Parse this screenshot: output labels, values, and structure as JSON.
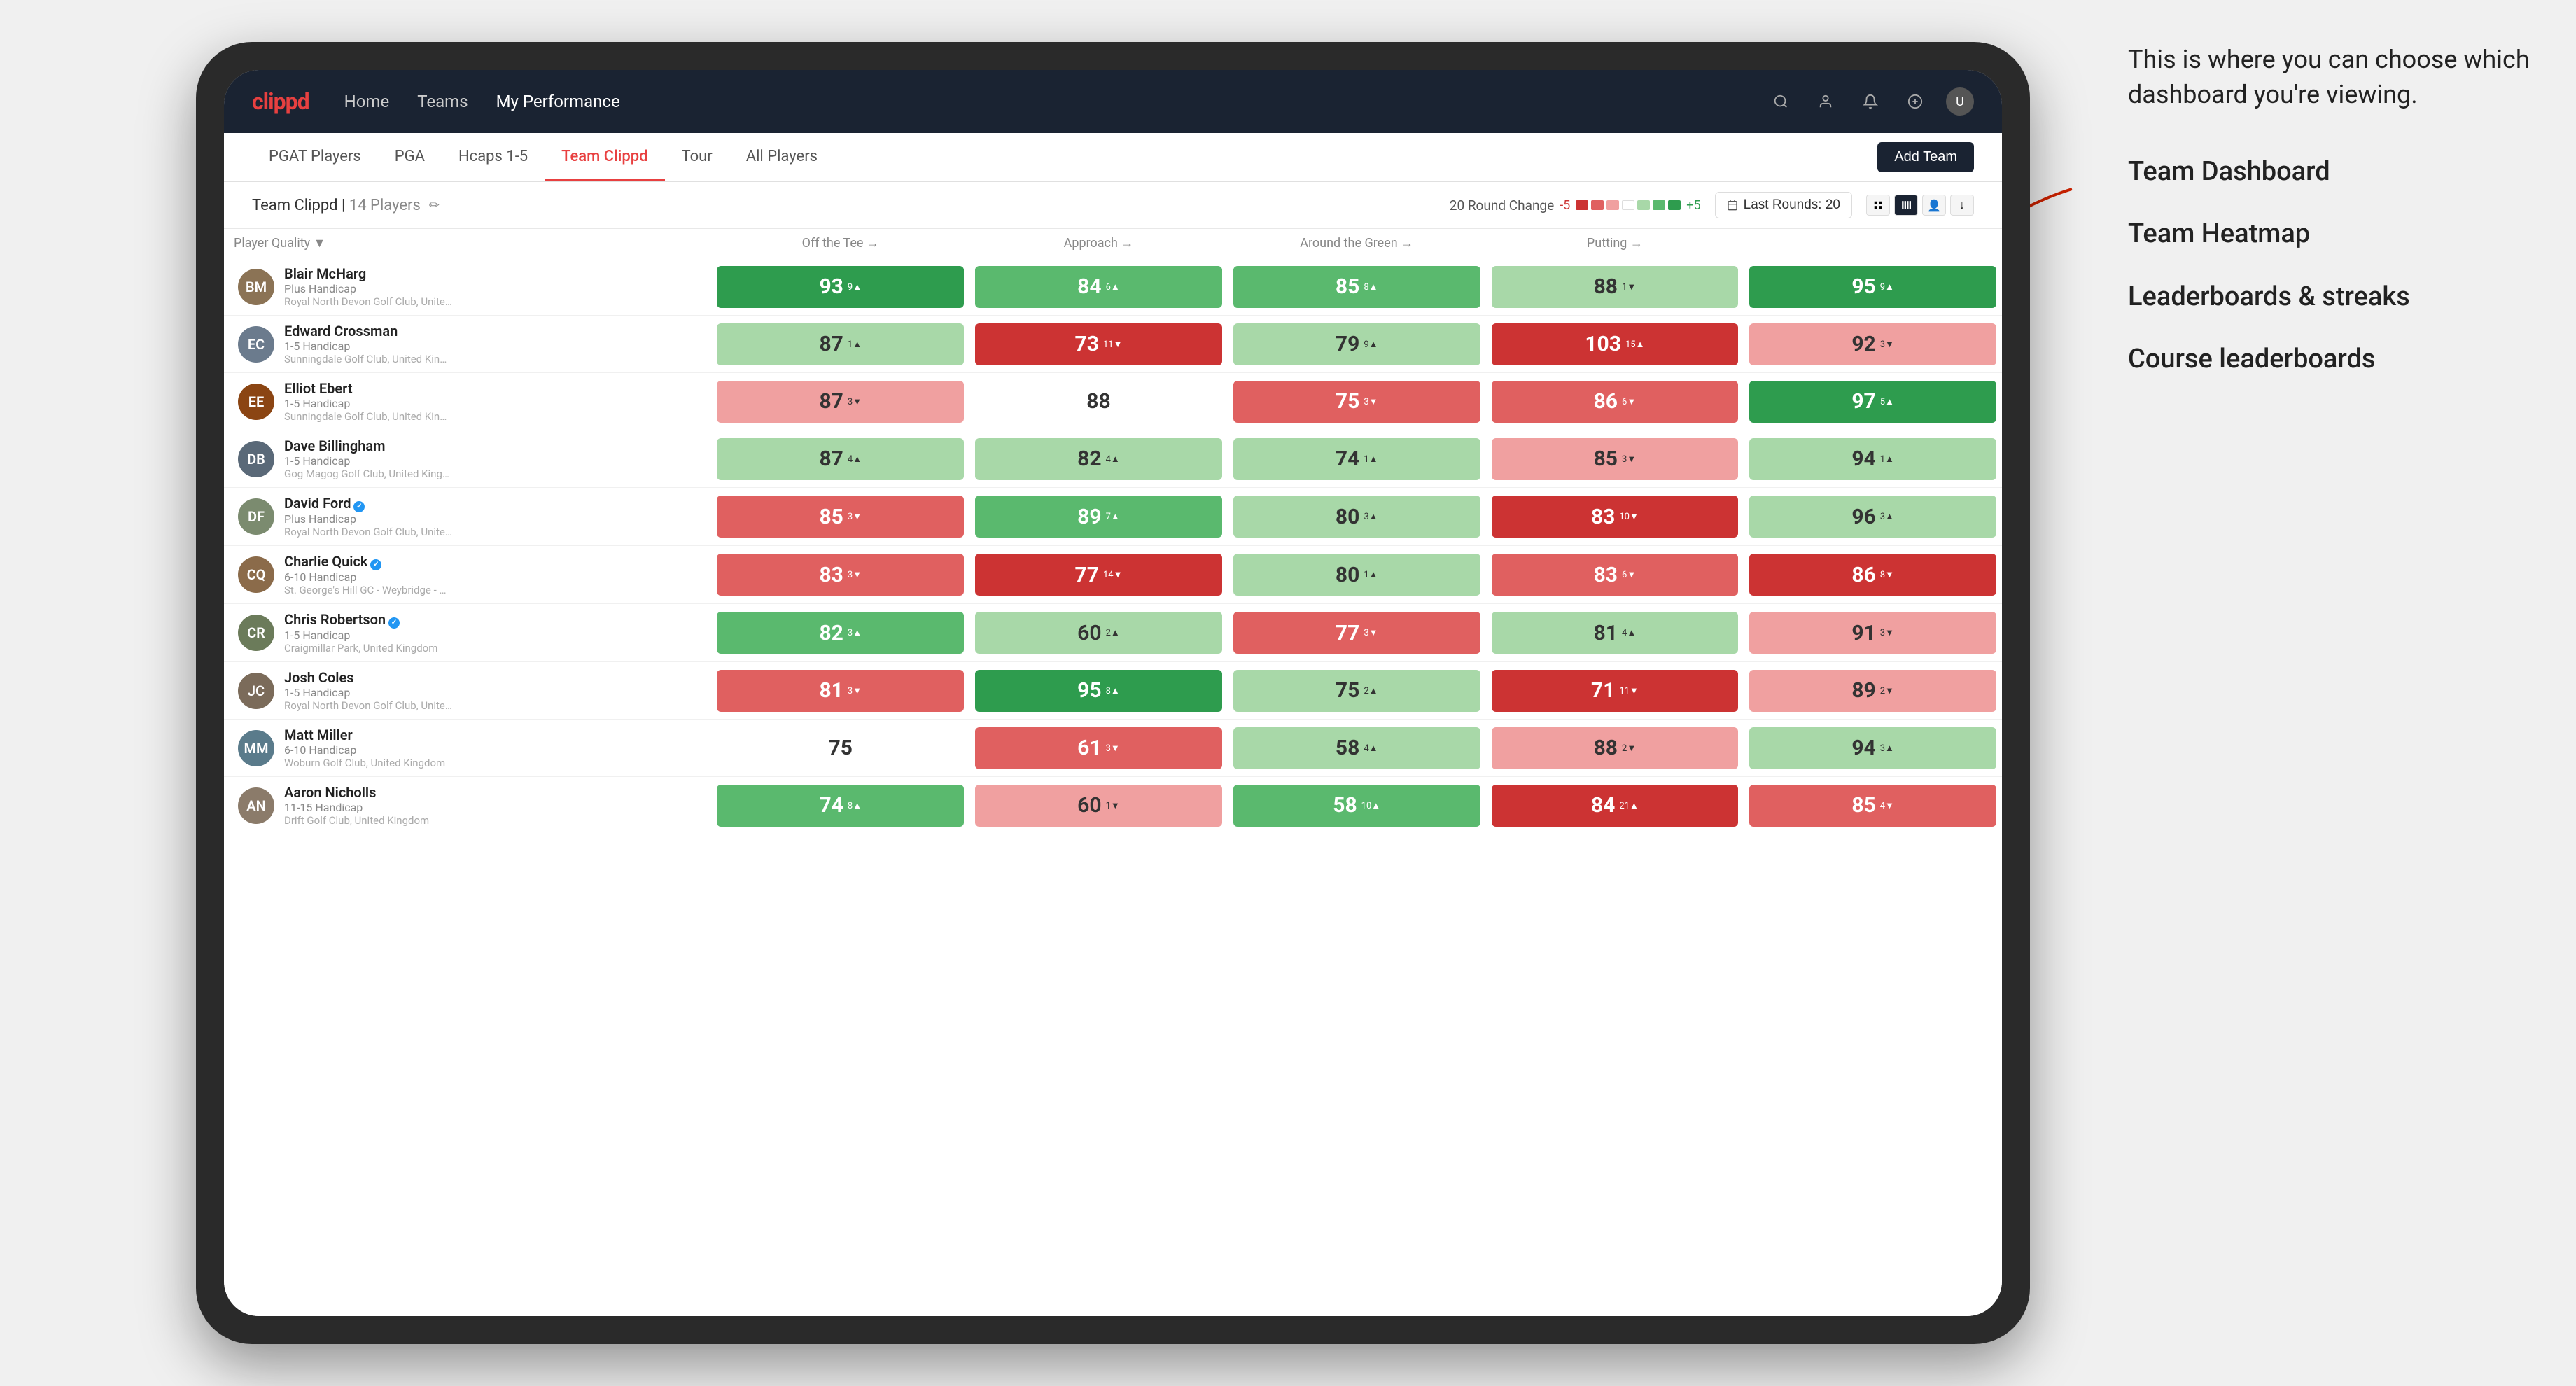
{
  "annotation": {
    "bubble_text": "This is where you can choose which dashboard you're viewing.",
    "list_items": [
      "Team Dashboard",
      "Team Heatmap",
      "Leaderboards & streaks",
      "Course leaderboards"
    ]
  },
  "navbar": {
    "logo": "clippd",
    "items": [
      {
        "label": "Home",
        "active": false
      },
      {
        "label": "Teams",
        "active": false
      },
      {
        "label": "My Performance",
        "active": true
      }
    ],
    "icons": [
      "search",
      "person",
      "bell",
      "circle-plus",
      "avatar"
    ]
  },
  "tabbar": {
    "tabs": [
      {
        "label": "PGAT Players",
        "active": false
      },
      {
        "label": "PGA",
        "active": false
      },
      {
        "label": "Hcaps 1-5",
        "active": false
      },
      {
        "label": "Team Clippd",
        "active": true
      },
      {
        "label": "Tour",
        "active": false
      },
      {
        "label": "All Players",
        "active": false
      }
    ],
    "add_team_label": "Add Team"
  },
  "team_header": {
    "title": "Team Clippd",
    "player_count": "14 Players",
    "round_change_label": "20 Round Change",
    "round_change_min": "-5",
    "round_change_max": "+5",
    "last_rounds_label": "Last Rounds:",
    "last_rounds_value": "20"
  },
  "table": {
    "columns": [
      {
        "key": "player",
        "label": "Player Quality ↓"
      },
      {
        "key": "off_tee",
        "label": "Off the Tee →"
      },
      {
        "key": "approach",
        "label": "Approach →"
      },
      {
        "key": "around_green",
        "label": "Around the Green →"
      },
      {
        "key": "putting",
        "label": "Putting →"
      }
    ],
    "players": [
      {
        "name": "Blair McHarg",
        "handicap": "Plus Handicap",
        "club": "Royal North Devon Golf Club, United Kingdom",
        "avatar_color": "#8B7355",
        "initials": "BM",
        "off_tee": {
          "value": "93",
          "change": "9",
          "dir": "up",
          "bg": "green-strong"
        },
        "approach": {
          "value": "84",
          "change": "6",
          "dir": "up",
          "bg": "green-medium"
        },
        "around_green": {
          "value": "85",
          "change": "8",
          "dir": "up",
          "bg": "green-medium"
        },
        "putting": {
          "value": "88",
          "change": "1",
          "dir": "down",
          "bg": "green-light"
        },
        "quality": {
          "value": "95",
          "change": "9",
          "dir": "up",
          "bg": "green-strong"
        }
      },
      {
        "name": "Edward Crossman",
        "handicap": "1-5 Handicap",
        "club": "Sunningdale Golf Club, United Kingdom",
        "avatar_color": "#6B7B8D",
        "initials": "EC",
        "off_tee": {
          "value": "87",
          "change": "1",
          "dir": "up",
          "bg": "green-light"
        },
        "approach": {
          "value": "73",
          "change": "11",
          "dir": "down",
          "bg": "red-strong"
        },
        "around_green": {
          "value": "79",
          "change": "9",
          "dir": "up",
          "bg": "green-light"
        },
        "putting": {
          "value": "103",
          "change": "15",
          "dir": "up",
          "bg": "red-strong"
        },
        "quality": {
          "value": "92",
          "change": "3",
          "dir": "down",
          "bg": "red-light"
        }
      },
      {
        "name": "Elliot Ebert",
        "handicap": "1-5 Handicap",
        "club": "Sunningdale Golf Club, United Kingdom",
        "avatar_color": "#8B4513",
        "initials": "EE",
        "off_tee": {
          "value": "87",
          "change": "3",
          "dir": "down",
          "bg": "red-light"
        },
        "approach": {
          "value": "88",
          "change": "",
          "dir": "none",
          "bg": "white"
        },
        "around_green": {
          "value": "75",
          "change": "3",
          "dir": "down",
          "bg": "red-medium"
        },
        "putting": {
          "value": "86",
          "change": "6",
          "dir": "down",
          "bg": "red-medium"
        },
        "quality": {
          "value": "97",
          "change": "5",
          "dir": "up",
          "bg": "green-strong"
        }
      },
      {
        "name": "Dave Billingham",
        "handicap": "1-5 Handicap",
        "club": "Gog Magog Golf Club, United Kingdom",
        "avatar_color": "#5A6978",
        "initials": "DB",
        "off_tee": {
          "value": "87",
          "change": "4",
          "dir": "up",
          "bg": "green-light"
        },
        "approach": {
          "value": "82",
          "change": "4",
          "dir": "up",
          "bg": "green-light"
        },
        "around_green": {
          "value": "74",
          "change": "1",
          "dir": "up",
          "bg": "green-light"
        },
        "putting": {
          "value": "85",
          "change": "3",
          "dir": "down",
          "bg": "red-light"
        },
        "quality": {
          "value": "94",
          "change": "1",
          "dir": "up",
          "bg": "green-light"
        }
      },
      {
        "name": "David Ford",
        "handicap": "Plus Handicap",
        "club": "Royal North Devon Golf Club, United Kingdom",
        "avatar_color": "#7B8B6F",
        "initials": "DF",
        "verified": true,
        "off_tee": {
          "value": "85",
          "change": "3",
          "dir": "down",
          "bg": "red-medium"
        },
        "approach": {
          "value": "89",
          "change": "7",
          "dir": "up",
          "bg": "green-medium"
        },
        "around_green": {
          "value": "80",
          "change": "3",
          "dir": "up",
          "bg": "green-light"
        },
        "putting": {
          "value": "83",
          "change": "10",
          "dir": "down",
          "bg": "red-strong"
        },
        "quality": {
          "value": "96",
          "change": "3",
          "dir": "up",
          "bg": "green-light"
        }
      },
      {
        "name": "Charlie Quick",
        "handicap": "6-10 Handicap",
        "club": "St. George's Hill GC - Weybridge - Surrey, Uni...",
        "avatar_color": "#8B6B4A",
        "initials": "CQ",
        "verified": true,
        "off_tee": {
          "value": "83",
          "change": "3",
          "dir": "down",
          "bg": "red-medium"
        },
        "approach": {
          "value": "77",
          "change": "14",
          "dir": "down",
          "bg": "red-strong"
        },
        "around_green": {
          "value": "80",
          "change": "1",
          "dir": "up",
          "bg": "green-light"
        },
        "putting": {
          "value": "83",
          "change": "6",
          "dir": "down",
          "bg": "red-medium"
        },
        "quality": {
          "value": "86",
          "change": "8",
          "dir": "down",
          "bg": "red-strong"
        }
      },
      {
        "name": "Chris Robertson",
        "handicap": "1-5 Handicap",
        "club": "Craigmillar Park, United Kingdom",
        "avatar_color": "#6B7B5A",
        "initials": "CR",
        "verified": true,
        "off_tee": {
          "value": "82",
          "change": "3",
          "dir": "up",
          "bg": "green-medium"
        },
        "approach": {
          "value": "60",
          "change": "2",
          "dir": "up",
          "bg": "green-light"
        },
        "around_green": {
          "value": "77",
          "change": "3",
          "dir": "down",
          "bg": "red-medium"
        },
        "putting": {
          "value": "81",
          "change": "4",
          "dir": "up",
          "bg": "green-light"
        },
        "quality": {
          "value": "91",
          "change": "3",
          "dir": "down",
          "bg": "red-light"
        }
      },
      {
        "name": "Josh Coles",
        "handicap": "1-5 Handicap",
        "club": "Royal North Devon Golf Club, United Kingdom",
        "avatar_color": "#7B6B5A",
        "initials": "JC",
        "off_tee": {
          "value": "81",
          "change": "3",
          "dir": "down",
          "bg": "red-medium"
        },
        "approach": {
          "value": "95",
          "change": "8",
          "dir": "up",
          "bg": "green-strong"
        },
        "around_green": {
          "value": "75",
          "change": "2",
          "dir": "up",
          "bg": "green-light"
        },
        "putting": {
          "value": "71",
          "change": "11",
          "dir": "down",
          "bg": "red-strong"
        },
        "quality": {
          "value": "89",
          "change": "2",
          "dir": "down",
          "bg": "red-light"
        }
      },
      {
        "name": "Matt Miller",
        "handicap": "6-10 Handicap",
        "club": "Woburn Golf Club, United Kingdom",
        "avatar_color": "#5A7B8B",
        "initials": "MM",
        "off_tee": {
          "value": "75",
          "change": "",
          "dir": "none",
          "bg": "white"
        },
        "approach": {
          "value": "61",
          "change": "3",
          "dir": "down",
          "bg": "red-medium"
        },
        "around_green": {
          "value": "58",
          "change": "4",
          "dir": "up",
          "bg": "green-light"
        },
        "putting": {
          "value": "88",
          "change": "2",
          "dir": "down",
          "bg": "red-light"
        },
        "quality": {
          "value": "94",
          "change": "3",
          "dir": "up",
          "bg": "green-light"
        }
      },
      {
        "name": "Aaron Nicholls",
        "handicap": "11-15 Handicap",
        "club": "Drift Golf Club, United Kingdom",
        "avatar_color": "#8B7B6A",
        "initials": "AN",
        "off_tee": {
          "value": "74",
          "change": "8",
          "dir": "up",
          "bg": "green-medium"
        },
        "approach": {
          "value": "60",
          "change": "1",
          "dir": "down",
          "bg": "red-light"
        },
        "around_green": {
          "value": "58",
          "change": "10",
          "dir": "up",
          "bg": "green-medium"
        },
        "putting": {
          "value": "84",
          "change": "21",
          "dir": "up",
          "bg": "red-strong"
        },
        "quality": {
          "value": "85",
          "change": "4",
          "dir": "down",
          "bg": "red-medium"
        }
      }
    ]
  }
}
